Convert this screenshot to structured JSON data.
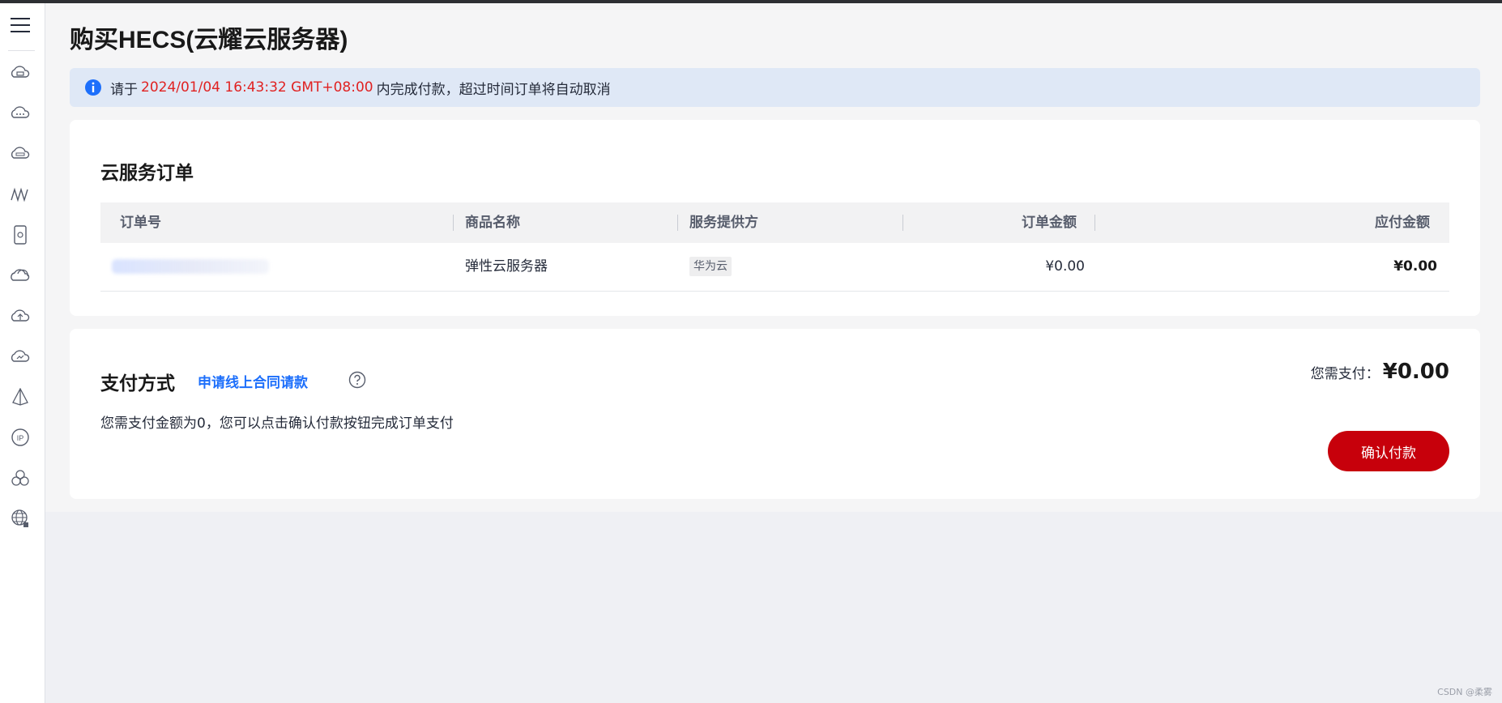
{
  "page": {
    "title": "购买HECS(云耀云服务器)"
  },
  "notice": {
    "prefix": "请于",
    "deadline": "2024/01/04 16:43:32 GMT+08:00",
    "suffix": "内完成付款，超过时间订单将自动取消"
  },
  "orders": {
    "title": "云服务订单",
    "columns": [
      "订单号",
      "商品名称",
      "服务提供方",
      "订单金额",
      "应付金额"
    ],
    "rows": [
      {
        "order_id": "",
        "product": "弹性云服务器",
        "provider": "华为云",
        "amount": "¥0.00",
        "payable": "¥0.00"
      }
    ]
  },
  "payment": {
    "title": "支付方式",
    "contract_link": "申请线上合同请款",
    "description": "您需支付金额为0，您可以点击确认付款按钮完成订单支付",
    "amount_label": "您需支付：",
    "amount_value": "¥0.00",
    "confirm_label": "确认付款"
  },
  "sidebar": {
    "icons": [
      "menu-icon",
      "ecs-icon",
      "cloud-icon",
      "vpc-icon",
      "mountain-icon",
      "phone-icon",
      "cloud-storage-icon",
      "cloud-upload-icon",
      "cloud-sync-icon",
      "pyramid-icon",
      "ip-icon",
      "cluster-icon",
      "globe-icon"
    ]
  },
  "watermark": "CSDN @柔雾",
  "colors": {
    "accent": "#c7000b",
    "link": "#1d6ffb",
    "deadline": "#e02222",
    "notice_bg": "#dfe8f6"
  }
}
